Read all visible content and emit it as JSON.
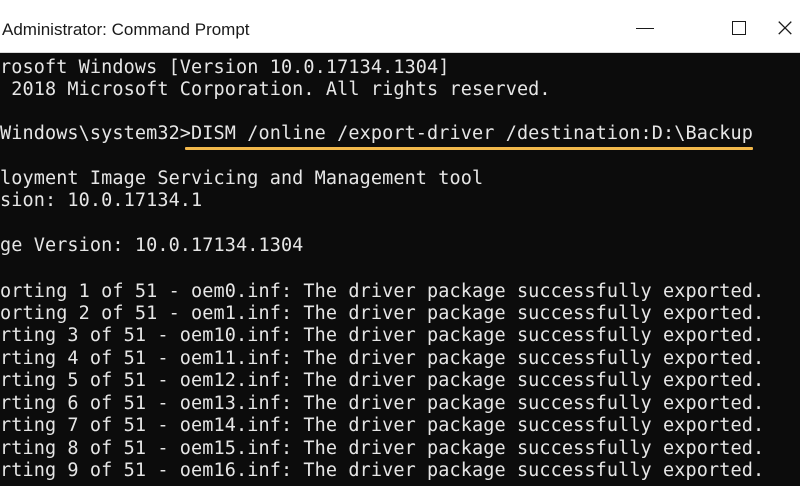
{
  "window": {
    "title": "Administrator: Command Prompt",
    "controls": {
      "minimize_icon": "minimize-icon",
      "maximize_icon": "maximize-icon",
      "close_label": "×"
    }
  },
  "console": {
    "highlight_color": "#f2b84b",
    "lines": [
      "rosoft Windows [Version 10.0.17134.1304]",
      " 2018 Microsoft Corporation. All rights reserved.",
      "",
      "Windows\\system32>DISM /online /export-driver /destination:D:\\Backup",
      "",
      "loyment Image Servicing and Management tool",
      "sion: 10.0.17134.1",
      "",
      "ge Version: 10.0.17134.1304",
      "",
      "orting 1 of 51 - oem0.inf: The driver package successfully exported.",
      "orting 2 of 51 - oem1.inf: The driver package successfully exported.",
      "rting 3 of 51 - oem10.inf: The driver package successfully exported.",
      "rting 4 of 51 - oem11.inf: The driver package successfully exported.",
      "rting 5 of 51 - oem12.inf: The driver package successfully exported.",
      "rting 6 of 51 - oem13.inf: The driver package successfully exported.",
      "rting 7 of 51 - oem14.inf: The driver package successfully exported.",
      "rting 8 of 51 - oem15.inf: The driver package successfully exported.",
      "rting 9 of 51 - oem16.inf: The driver package successfully exported."
    ]
  }
}
